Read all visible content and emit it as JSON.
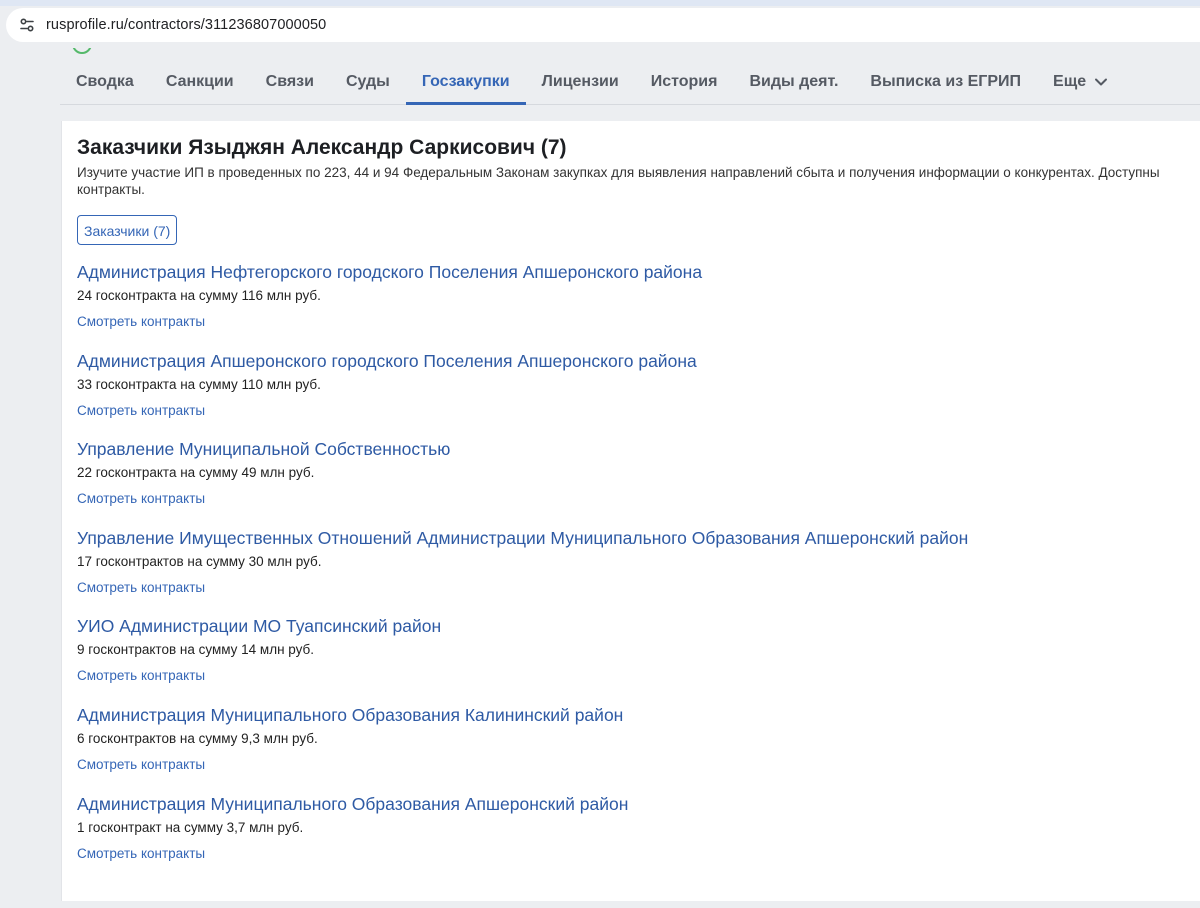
{
  "browser": {
    "url": "rusprofile.ru/contractors/311236807000050"
  },
  "page": {
    "tabs": [
      {
        "label": "Сводка"
      },
      {
        "label": "Санкции"
      },
      {
        "label": "Связи"
      },
      {
        "label": "Суды"
      },
      {
        "label": "Госзакупки"
      },
      {
        "label": "Лицензии"
      },
      {
        "label": "История"
      },
      {
        "label": "Виды деят."
      },
      {
        "label": "Выписка из ЕГРИП"
      },
      {
        "label": "Еще"
      }
    ],
    "active_tab": "Госзакупки"
  },
  "section": {
    "heading": "Заказчики Языджян Александр Саркисович (7)",
    "description": "Изучите участие ИП в проведенных по 223, 44 и 94 Федеральным Законам закупках для выявления направлений сбыта и получения информации о конкурентах. Доступны контракты.",
    "filter_label": "Заказчики (7)"
  },
  "customers": [
    {
      "name": "Администрация Нефтегорского городского Поселения Апшеронского района",
      "stats": "24 госконтракта на сумму 116 млн руб.",
      "link": "Смотреть контракты"
    },
    {
      "name": "Администрация Апшеронского городского Поселения Апшеронского района",
      "stats": "33 госконтракта на сумму 110 млн руб.",
      "link": "Смотреть контракты"
    },
    {
      "name": "Управление Муниципальной Собственностью",
      "stats": "22 госконтракта на сумму 49 млн руб.",
      "link": "Смотреть контракты"
    },
    {
      "name": "Управление Имущественных Отношений Администрации Муниципального Образования Апшеронский район",
      "stats": "17 госконтрактов на сумму 30 млн руб.",
      "link": "Смотреть контракты"
    },
    {
      "name": "УИО Администрации МО Туапсинский район",
      "stats": "9 госконтрактов на сумму 14 млн руб.",
      "link": "Смотреть контракты"
    },
    {
      "name": "Администрация Муниципального Образования Калининский район",
      "stats": "6 госконтрактов на сумму 9,3 млн руб.",
      "link": "Смотреть контракты"
    },
    {
      "name": "Администрация Муниципального Образования Апшеронский район",
      "stats": "1 госконтракт на сумму 3,7 млн руб.",
      "link": "Смотреть контракты"
    }
  ],
  "colors": {
    "accent": "#3566b6",
    "link": "#2e5aa4",
    "background": "#eceef1"
  }
}
